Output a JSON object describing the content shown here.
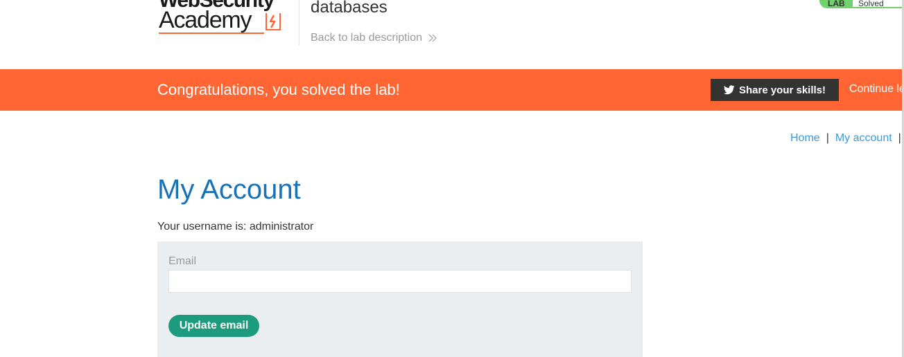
{
  "header": {
    "logo": {
      "line1": "WebSecurity",
      "line2": "Academy",
      "mark_icon": "lightning-icon"
    },
    "lab_title": "databases",
    "back_link": "Back to lab description",
    "back_icon": "double-chevron-right-icon",
    "status": {
      "left_label": "LAB",
      "right_label": "Solved",
      "color": "#70d16d"
    }
  },
  "banner": {
    "message": "Congratulations, you solved the lab!",
    "share_label": "Share your skills!",
    "share_icon": "twitter-icon",
    "continue_label": "Continue le",
    "color": "#ff6633"
  },
  "nav": {
    "items": [
      {
        "label": "Home"
      },
      {
        "label": "My account"
      }
    ],
    "separator": "|"
  },
  "main": {
    "title": "My Account",
    "username_text": "Your username is: administrator",
    "form": {
      "email_label": "Email",
      "email_value": "",
      "submit_label": "Update email"
    }
  },
  "colors": {
    "title": "#1772b8",
    "link": "#3d9ad6",
    "button": "#1c9c7c",
    "panel": "#eaeef0"
  }
}
